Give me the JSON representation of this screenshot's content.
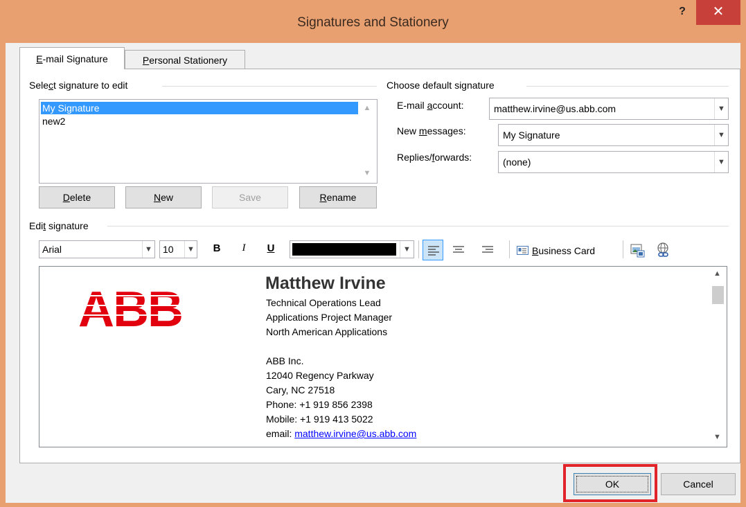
{
  "window": {
    "title": "Signatures and Stationery",
    "help_label": "?",
    "close_label": "✕"
  },
  "tabs": [
    {
      "label_pre": "",
      "label_key": "E",
      "label_post": "-mail Signature",
      "active": true
    },
    {
      "label_pre": "",
      "label_key": "P",
      "label_post": "ersonal Stationery",
      "active": false
    }
  ],
  "select_group": {
    "label_pre": "Sele",
    "label_key": "c",
    "label_post": "t signature to edit",
    "items": [
      "My Signature",
      "new2"
    ],
    "selected": "My Signature"
  },
  "list_buttons": {
    "delete": {
      "key": "D",
      "rest": "elete"
    },
    "new": {
      "key": "N",
      "rest": "ew"
    },
    "save": "Save",
    "rename": {
      "key": "R",
      "rest": "ename"
    }
  },
  "default_group": {
    "label": "Choose default signature",
    "email_account_label_pre": "E-mail ",
    "email_account_label_key": "a",
    "email_account_label_post": "ccount:",
    "email_account_value": "matthew.irvine@us.abb.com",
    "new_messages_label_pre": "New ",
    "new_messages_label_key": "m",
    "new_messages_label_post": "essages:",
    "new_messages_value": "My Signature",
    "replies_label_pre": "Replies/",
    "replies_label_key": "f",
    "replies_label_post": "orwards:",
    "replies_value": "(none)"
  },
  "edit_group": {
    "label_pre": "Edi",
    "label_key": "t",
    "label_post": " signature"
  },
  "toolbar": {
    "font": "Arial",
    "size": "10",
    "bold": "B",
    "italic": "I",
    "underline": "U",
    "font_color": "#000000",
    "business_card_key": "B",
    "business_card_rest": "usiness Card",
    "icons": [
      "align-left-icon",
      "align-center-icon",
      "align-right-icon",
      "business-card-icon",
      "insert-picture-icon",
      "insert-hyperlink-icon"
    ]
  },
  "signature": {
    "logo_text": "ABB",
    "logo_color": "#e2000f",
    "name": "Matthew Irvine",
    "lines": [
      "Technical Operations Lead",
      "Applications Project Manager",
      "North American Applications",
      "",
      "ABB Inc.",
      "12040 Regency Parkway",
      "Cary, NC 27518",
      "Phone: +1 919 856 2398",
      "Mobile: +1 919 413 5022"
    ],
    "email_prefix": "email: ",
    "email_link": "matthew.irvine@us.abb.com",
    "link_color": "#0000ff"
  },
  "footer": {
    "ok": "OK",
    "cancel": "Cancel",
    "highlight_color": "#e0242a"
  }
}
